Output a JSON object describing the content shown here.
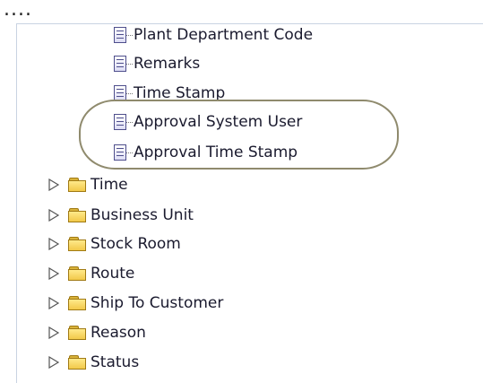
{
  "top_ellipsis": "....",
  "tree": {
    "columns": [
      {
        "label": "Plant Department Code"
      },
      {
        "label": "Remarks"
      },
      {
        "label": "Time Stamp"
      },
      {
        "label": "Approval System User"
      },
      {
        "label": "Approval Time Stamp"
      }
    ],
    "folders": [
      {
        "label": "Time"
      },
      {
        "label": "Business Unit"
      },
      {
        "label": "Stock Room"
      },
      {
        "label": "Route"
      },
      {
        "label": "Ship To Customer"
      },
      {
        "label": "Reason"
      },
      {
        "label": "Status"
      }
    ]
  },
  "colors": {
    "folder_fill": "#f2c94a",
    "column_icon": "#4e4e8c",
    "highlight_ring": "#8f8a6d",
    "panel_border": "#c9d3e2"
  }
}
